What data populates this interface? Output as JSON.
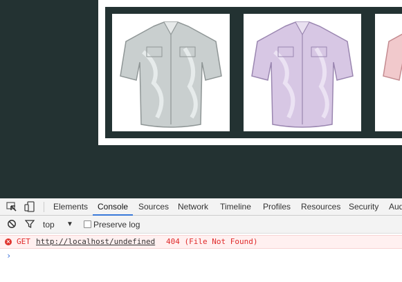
{
  "page": {
    "products": [
      {
        "alt": "grey-shirt",
        "color": "#c9cfcf",
        "shade": "#8f9696"
      },
      {
        "alt": "lavender-shirt",
        "color": "#d7c7e4",
        "shade": "#9a86b0"
      },
      {
        "alt": "pink-shirt",
        "color": "#f1c9cc",
        "shade": "#c48b90"
      }
    ]
  },
  "devtools": {
    "tabs": [
      "Elements",
      "Console",
      "Sources",
      "Network",
      "Timeline",
      "Profiles",
      "Resources",
      "Security",
      "Audits"
    ],
    "active_tab": "Console",
    "icons": {
      "inspect": "inspect-element-icon",
      "device": "device-mode-icon"
    },
    "filter_bar": {
      "context": "top",
      "preserve_log_label": "Preserve log",
      "preserve_log_checked": false
    },
    "console": {
      "messages": [
        {
          "level": "error",
          "method": "GET",
          "url": "http://localhost/undefined",
          "status": "404 (File Not Found)"
        }
      ],
      "prompt": "›"
    },
    "colors": {
      "accent": "#3879d9",
      "error_text": "#e02a2a",
      "error_bg": "#fff0f0",
      "page_bg": "#233232"
    }
  }
}
